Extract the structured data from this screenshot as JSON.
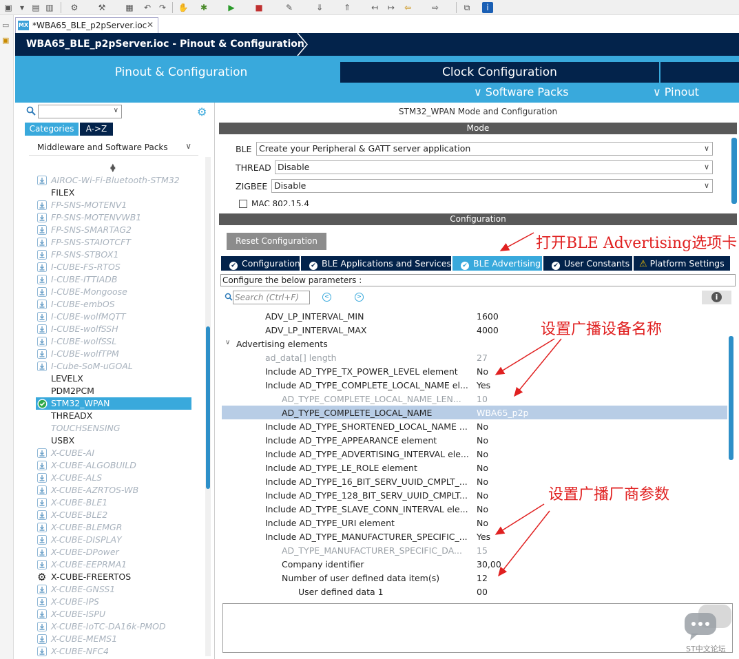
{
  "editor_tab": {
    "badge": "MX",
    "label": "*WBA65_BLE_p2pServer.ioc",
    "close": "✕"
  },
  "title": "WBA65_BLE_p2pServer.ioc - Pinout & Configuration",
  "main_tabs": {
    "pinout": "Pinout & Configuration",
    "clock": "Clock Configuration"
  },
  "submenus": {
    "software_packs": "∨ Software Packs",
    "pinout": "∨ Pinout"
  },
  "left": {
    "categories_tab": "Categories",
    "az_tab": "A->Z",
    "group_header": "Middleware and Software Packs",
    "items": [
      {
        "label": "AIROC-Wi-Fi-Bluetooth-STM32",
        "state": "dl"
      },
      {
        "label": "FILEX",
        "state": "plain"
      },
      {
        "label": "FP-SNS-MOTENV1",
        "state": "dl"
      },
      {
        "label": "FP-SNS-MOTENVWB1",
        "state": "dl"
      },
      {
        "label": "FP-SNS-SMARTAG2",
        "state": "dl"
      },
      {
        "label": "FP-SNS-STAIOTCFT",
        "state": "dl"
      },
      {
        "label": "FP-SNS-STBOX1",
        "state": "dl"
      },
      {
        "label": "I-CUBE-FS-RTOS",
        "state": "dl"
      },
      {
        "label": "I-CUBE-ITTIADB",
        "state": "dl"
      },
      {
        "label": "I-CUBE-Mongoose",
        "state": "dl"
      },
      {
        "label": "I-CUBE-embOS",
        "state": "dl"
      },
      {
        "label": "I-CUBE-wolfMQTT",
        "state": "dl"
      },
      {
        "label": "I-CUBE-wolfSSH",
        "state": "dl"
      },
      {
        "label": "I-CUBE-wolfSSL",
        "state": "dl"
      },
      {
        "label": "I-CUBE-wolfTPM",
        "state": "dl"
      },
      {
        "label": "I-Cube-SoM-uGOAL",
        "state": "dl"
      },
      {
        "label": "LEVELX",
        "state": "plain"
      },
      {
        "label": "PDM2PCM",
        "state": "plain"
      },
      {
        "label": "STM32_WPAN",
        "state": "selected"
      },
      {
        "label": "THREADX",
        "state": "plain"
      },
      {
        "label": "TOUCHSENSING",
        "state": "disabled"
      },
      {
        "label": "USBX",
        "state": "plain"
      },
      {
        "label": "X-CUBE-AI",
        "state": "dl"
      },
      {
        "label": "X-CUBE-ALGOBUILD",
        "state": "dl"
      },
      {
        "label": "X-CUBE-ALS",
        "state": "dl"
      },
      {
        "label": "X-CUBE-AZRTOS-WB",
        "state": "dl"
      },
      {
        "label": "X-CUBE-BLE1",
        "state": "dl"
      },
      {
        "label": "X-CUBE-BLE2",
        "state": "dl"
      },
      {
        "label": "X-CUBE-BLEMGR",
        "state": "dl"
      },
      {
        "label": "X-CUBE-DISPLAY",
        "state": "dl"
      },
      {
        "label": "X-CUBE-DPower",
        "state": "dl"
      },
      {
        "label": "X-CUBE-EEPRMA1",
        "state": "dl"
      },
      {
        "label": "X-CUBE-FREERTOS",
        "state": "gear"
      },
      {
        "label": "X-CUBE-GNSS1",
        "state": "dl"
      },
      {
        "label": "X-CUBE-IPS",
        "state": "dl"
      },
      {
        "label": "X-CUBE-ISPU",
        "state": "dl"
      },
      {
        "label": "X-CUBE-IoTC-DA16k-PMOD",
        "state": "dl"
      },
      {
        "label": "X-CUBE-MEMS1",
        "state": "dl"
      },
      {
        "label": "X-CUBE-NFC4",
        "state": "dl"
      }
    ]
  },
  "right": {
    "mode_title": "STM32_WPAN Mode and Configuration",
    "mode_bar": "Mode",
    "mode_rows": [
      {
        "label": "BLE",
        "value": "Create your Peripheral & GATT server application"
      },
      {
        "label": "THREAD",
        "value": "Disable"
      },
      {
        "label": "ZIGBEE",
        "value": "Disable"
      }
    ],
    "mac_label": "MAC 802.15.4",
    "config_bar": "Configuration",
    "reset_button": "Reset Configuration",
    "tabs": [
      {
        "label": "Configuration",
        "icon": "ok"
      },
      {
        "label": "BLE Applications and Services",
        "icon": "ok"
      },
      {
        "label": "BLE Advertising",
        "icon": "ok",
        "active": true
      },
      {
        "label": "User Constants",
        "icon": "ok"
      },
      {
        "label": "Platform Settings",
        "icon": "warn"
      }
    ],
    "params_desc": "Configure the below parameters :",
    "search_placeholder": "Search (Ctrl+F)",
    "params": [
      {
        "name": "ADV_LP_INTERVAL_MIN",
        "value": "1600",
        "indent": 1,
        "style": "normal"
      },
      {
        "name": "ADV_LP_INTERVAL_MAX",
        "value": "4000",
        "indent": 1,
        "style": "normal"
      },
      {
        "name": "Advertising elements",
        "value": "",
        "indent": 0,
        "style": "group"
      },
      {
        "name": "ad_data[] length",
        "value": "27",
        "indent": 1,
        "style": "grey"
      },
      {
        "name": "Include AD_TYPE_TX_POWER_LEVEL element",
        "value": "No",
        "indent": 1,
        "style": "normal"
      },
      {
        "name": "Include AD_TYPE_COMPLETE_LOCAL_NAME el...",
        "value": "Yes",
        "indent": 1,
        "style": "normal"
      },
      {
        "name": "AD_TYPE_COMPLETE_LOCAL_NAME_LEN...",
        "value": "10",
        "indent": 2,
        "style": "grey"
      },
      {
        "name": "AD_TYPE_COMPLETE_LOCAL_NAME",
        "value": "WBA65_p2p",
        "indent": 2,
        "style": "selected"
      },
      {
        "name": "Include AD_TYPE_SHORTENED_LOCAL_NAME ...",
        "value": "No",
        "indent": 1,
        "style": "normal"
      },
      {
        "name": "Include AD_TYPE_APPEARANCE element",
        "value": "No",
        "indent": 1,
        "style": "normal"
      },
      {
        "name": "Include AD_TYPE_ADVERTISING_INTERVAL ele...",
        "value": "No",
        "indent": 1,
        "style": "normal"
      },
      {
        "name": "Include AD_TYPE_LE_ROLE element",
        "value": "No",
        "indent": 1,
        "style": "normal"
      },
      {
        "name": "Include AD_TYPE_16_BIT_SERV_UUID_CMPLT_...",
        "value": "No",
        "indent": 1,
        "style": "normal"
      },
      {
        "name": "Include AD_TYPE_128_BIT_SERV_UUID_CMPLT...",
        "value": "No",
        "indent": 1,
        "style": "normal"
      },
      {
        "name": "Include AD_TYPE_SLAVE_CONN_INTERVAL ele...",
        "value": "No",
        "indent": 1,
        "style": "normal"
      },
      {
        "name": "Include AD_TYPE_URI element",
        "value": "No",
        "indent": 1,
        "style": "normal"
      },
      {
        "name": "Include AD_TYPE_MANUFACTURER_SPECIFIC_...",
        "value": "Yes",
        "indent": 1,
        "style": "normal"
      },
      {
        "name": "AD_TYPE_MANUFACTURER_SPECIFIC_DA...",
        "value": "15",
        "indent": 2,
        "style": "grey"
      },
      {
        "name": "Company identifier",
        "value": "30,00",
        "indent": 2,
        "style": "normal"
      },
      {
        "name": "Number of user defined data item(s)",
        "value": "12",
        "indent": 2,
        "style": "normal"
      },
      {
        "name": "User defined data 1",
        "value": "00",
        "indent": 3,
        "style": "normal"
      }
    ]
  },
  "annotations": {
    "open_tab": "打开BLE Advertising选项卡",
    "set_name": "设置广播设备名称",
    "set_manufacturer": "设置广播厂商参数"
  },
  "watermark": "ST中文论坛",
  "colors": {
    "navy": "#03234b",
    "accent": "#39a9dc",
    "annotation": "#e02020"
  }
}
